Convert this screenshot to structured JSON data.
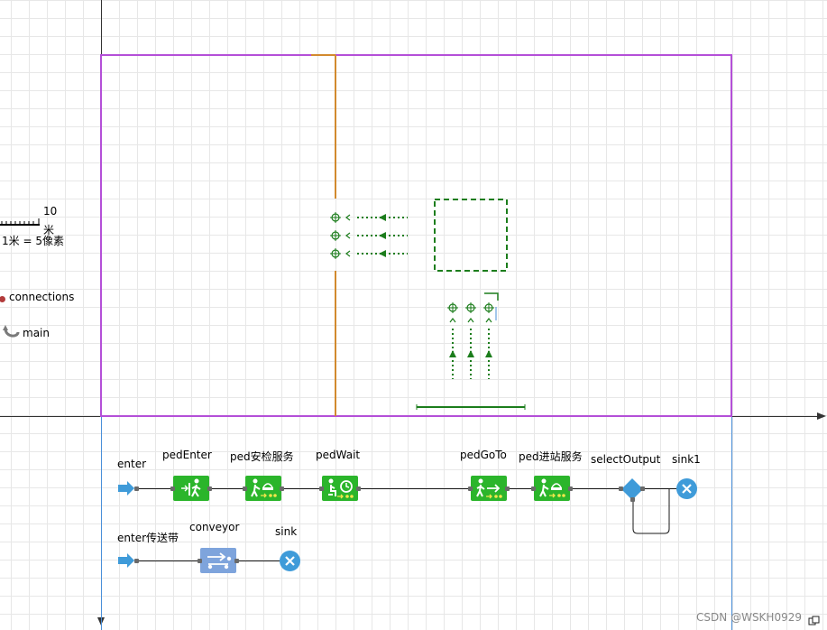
{
  "scale": {
    "value": "10",
    "unit": "米",
    "ratio": "1米 = 5像素"
  },
  "legend": {
    "connections": "connections",
    "main": "main"
  },
  "blocks": {
    "enter": "enter",
    "pedEnter": "pedEnter",
    "pedSecurity": "ped安检服务",
    "pedWait": "pedWait",
    "pedGoTo": "pedGoTo",
    "pedStation": "ped进站服务",
    "selectOutput": "selectOutput",
    "sink1": "sink1",
    "enterConveyor": "enter传送带",
    "conveyor": "conveyor",
    "sink": "sink"
  },
  "watermark": "CSDN @WSKH0929",
  "colors": {
    "boundary": "#b44fd8",
    "wall": "#d28a2e",
    "service": "#1c7d1c",
    "block": "#2bb52b",
    "sink": "#3f9bd9",
    "conveyor": "#7ea4dc"
  }
}
